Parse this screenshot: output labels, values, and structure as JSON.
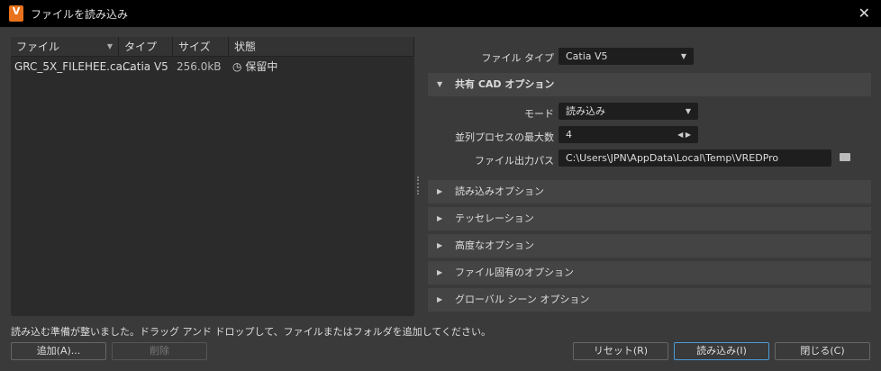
{
  "window": {
    "title": "ファイルを読み込み",
    "logo_text": "V",
    "close": "✕"
  },
  "file_list": {
    "headers": [
      "ファイル",
      "タイプ",
      "サイズ",
      "状態"
    ],
    "rows": [
      {
        "file": "GRC_5X_FILEHEE.ca...",
        "type": "Catia V5",
        "size": "256.0kB",
        "status": "保留中"
      }
    ]
  },
  "status_text": "読み込む準備が整いました。ドラッグ アンド ドロップして、ファイルまたはフォルダを追加してください。",
  "buttons": {
    "add": "追加(A)...",
    "remove": "削除",
    "reset": "リセット(R)",
    "import": "読み込み(I)",
    "close": "閉じる(C)"
  },
  "options": {
    "file_type_label": "ファイル タイプ",
    "file_type_value": "Catia V5",
    "shared_section": "共有 CAD オプション",
    "mode_label": "モード",
    "mode_value": "読み込み",
    "max_proc_label": "並列プロセスの最大数",
    "max_proc_value": "4",
    "output_path_label": "ファイル出力パス",
    "output_path_value": "C:\\Users\\JPN\\AppData\\Local\\Temp\\VREDPro",
    "sections": [
      "読み込みオプション",
      "テッセレーション",
      "高度なオプション",
      "ファイル固有のオプション",
      "グローバル シーン オプション"
    ]
  }
}
